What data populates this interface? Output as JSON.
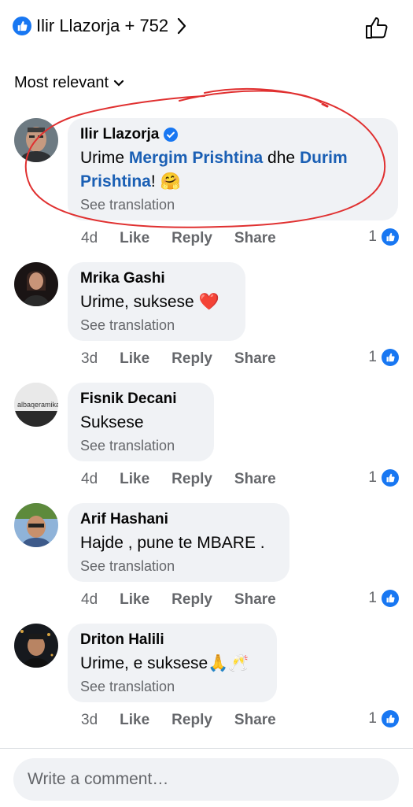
{
  "header": {
    "reactors_label": "Ilir Llazorja + 752"
  },
  "sort": {
    "label": "Most relevant"
  },
  "comments": [
    {
      "author": "Ilir Llazorja",
      "verified": true,
      "text_before": "Urime ",
      "mention1": "Mergim Prishtina",
      "text_mid": " dhe ",
      "mention2": "Durim Prishtina",
      "text_after": "! 🤗",
      "translate": "See translation",
      "time": "4d",
      "like": "Like",
      "reply": "Reply",
      "share": "Share",
      "reactions": "1"
    },
    {
      "author": "Mrika Gashi",
      "text": "Urime, suksese ❤️",
      "translate": "See translation",
      "time": "3d",
      "like": "Like",
      "reply": "Reply",
      "share": "Share",
      "reactions": "1"
    },
    {
      "author": "Fisnik Decani",
      "text": "Suksese",
      "translate": "See translation",
      "time": "4d",
      "like": "Like",
      "reply": "Reply",
      "share": "Share",
      "reactions": "1",
      "avatar_logo": "albaqeramika"
    },
    {
      "author": "Arif Hashani",
      "text": "Hajde , pune te MBARE .",
      "translate": "See translation",
      "time": "4d",
      "like": "Like",
      "reply": "Reply",
      "share": "Share",
      "reactions": "1"
    },
    {
      "author": "Driton Halili",
      "text": "Urime, e suksese🙏🥂",
      "translate": "See translation",
      "time": "3d",
      "like": "Like",
      "reply": "Reply",
      "share": "Share",
      "reactions": "1"
    }
  ],
  "composer": {
    "placeholder": "Write a comment…"
  },
  "colors": {
    "facebook_blue": "#1877f2",
    "bubble_bg": "#f0f2f5",
    "annotation_red": "#e03030"
  }
}
